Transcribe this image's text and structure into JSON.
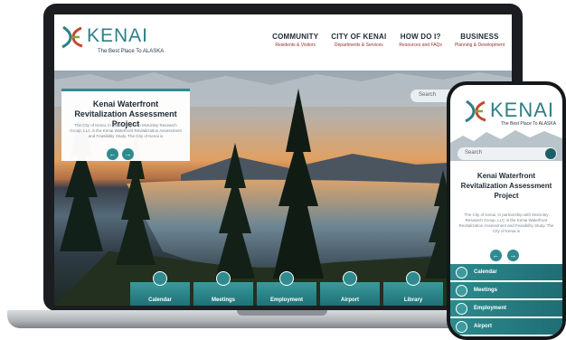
{
  "brand": {
    "name": "KENAI",
    "tagline": "The Best Place To ALASKA",
    "accent": "#2f7f86",
    "tile_color": "#2f8b8f"
  },
  "nav": [
    {
      "title": "COMMUNITY",
      "sub": "Residents & Visitors"
    },
    {
      "title": "CITY OF KENAI",
      "sub": "Departments & Services"
    },
    {
      "title": "HOW DO I?",
      "sub": "Resources and FAQs"
    },
    {
      "title": "BUSINESS",
      "sub": "Planning & Development"
    }
  ],
  "search": {
    "placeholder": "Search",
    "go_icon": "search-go-icon"
  },
  "feature": {
    "title": "Kenai Waterfront Revitalization Assessment Project",
    "body": "The City of Kenai, in partnership with McKinley Research Group, LLC is the Kenai Waterfront Revitalization Assessment and Feasibility Study. The City of Kenai is",
    "prev": "←",
    "next": "→"
  },
  "quick_links": [
    {
      "label": "Calendar",
      "icon": "calendar-icon"
    },
    {
      "label": "Meetings",
      "icon": "clock-icon"
    },
    {
      "label": "Employment",
      "icon": "people-icon"
    },
    {
      "label": "Airport",
      "icon": "airplane-icon"
    },
    {
      "label": "Library",
      "icon": "book-icon"
    }
  ],
  "mobile": {
    "search_placeholder": "Search",
    "feature_title": "Kenai Waterfront Revitalization Assessment Project",
    "feature_body": "The City of Kenai, in partnership with McKinley Research Group, LLC is the Kenai Waterfront Revitalization Assessment and Feasibility Study. The City of Kenai is",
    "prev": "←",
    "next": "→",
    "links": [
      {
        "label": "Calendar",
        "icon": "calendar-icon"
      },
      {
        "label": "Meetings",
        "icon": "clock-icon"
      },
      {
        "label": "Employment",
        "icon": "people-icon"
      },
      {
        "label": "Airport",
        "icon": "airplane-icon"
      }
    ]
  }
}
